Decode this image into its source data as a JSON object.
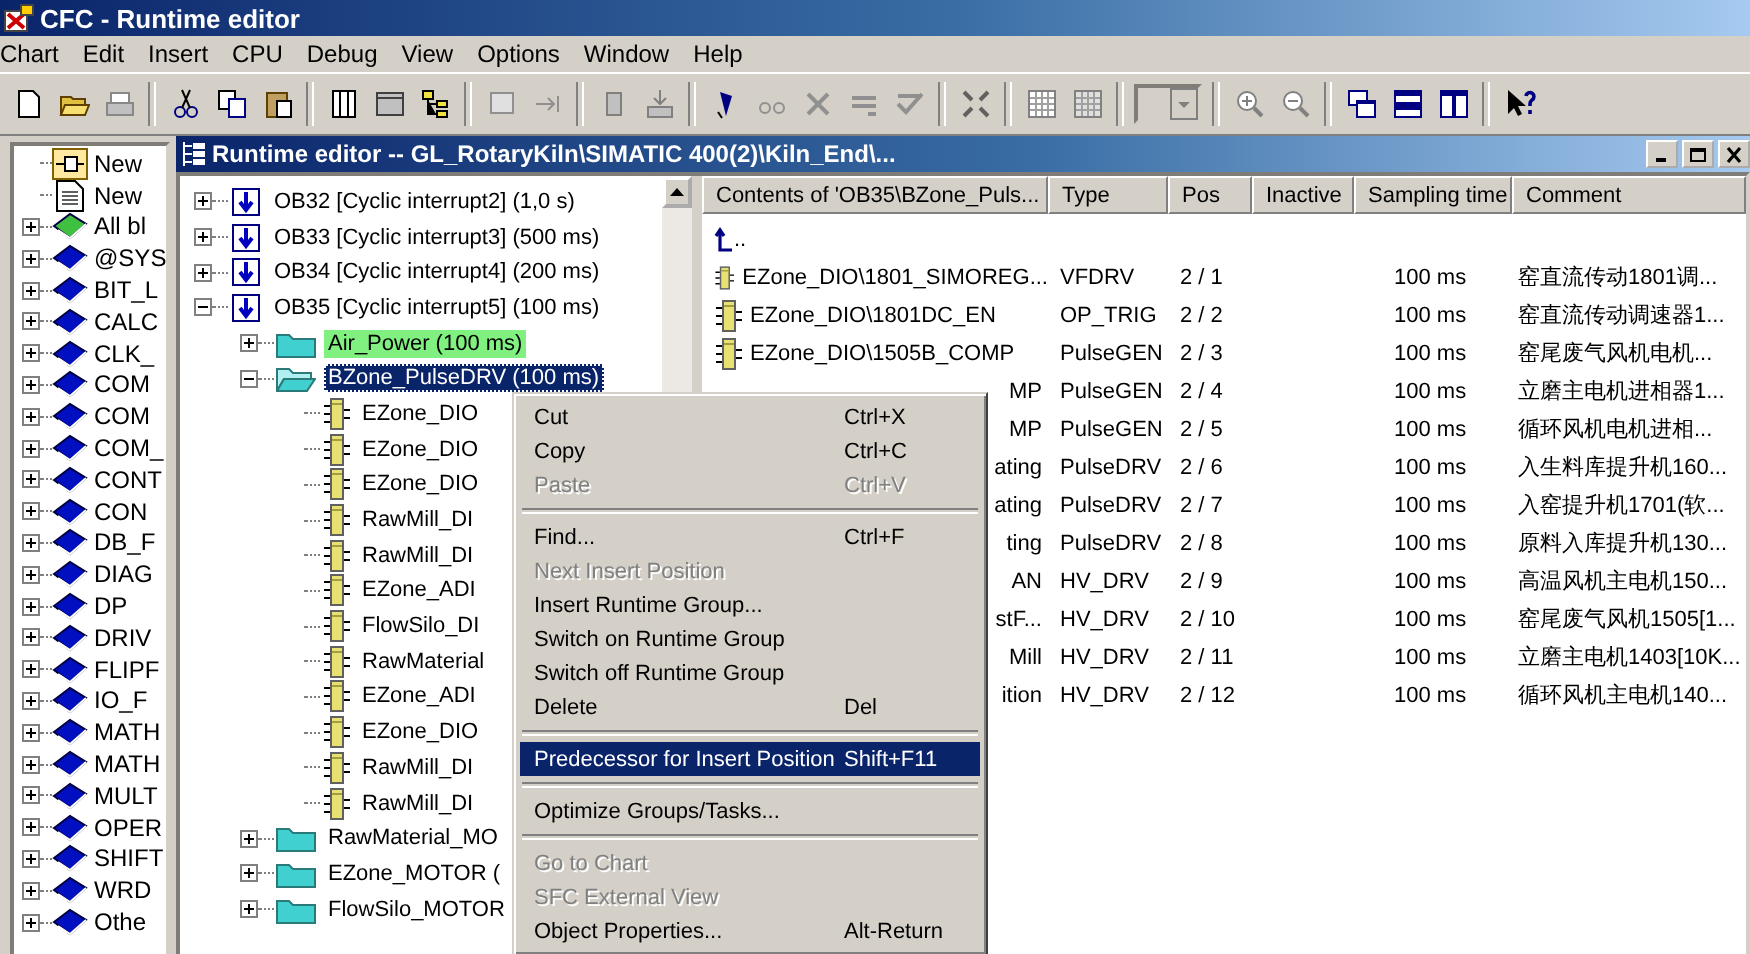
{
  "window": {
    "title": "CFC - Runtime editor"
  },
  "menu_bar": [
    "Chart",
    "Edit",
    "Insert",
    "CPU",
    "Debug",
    "View",
    "Options",
    "Window",
    "Help"
  ],
  "library": [
    {
      "kind": "new-chart",
      "label": "New"
    },
    {
      "kind": "new-doc",
      "label": "New"
    },
    {
      "kind": "library-all",
      "label": "All bl",
      "expanded": false
    },
    {
      "kind": "library",
      "label": "@SYS",
      "expanded": false
    },
    {
      "kind": "library",
      "label": "BIT_L",
      "expanded": false
    },
    {
      "kind": "library",
      "label": "CALC",
      "expanded": false
    },
    {
      "kind": "library",
      "label": "CLK_",
      "expanded": false
    },
    {
      "kind": "library",
      "label": "COM",
      "expanded": false
    },
    {
      "kind": "library",
      "label": "COM",
      "expanded": false
    },
    {
      "kind": "library",
      "label": "COM_",
      "expanded": false
    },
    {
      "kind": "library",
      "label": "CONT",
      "expanded": false
    },
    {
      "kind": "library",
      "label": "CON",
      "expanded": false
    },
    {
      "kind": "library",
      "label": "DB_F",
      "expanded": false
    },
    {
      "kind": "library",
      "label": "DIAG",
      "expanded": false
    },
    {
      "kind": "library",
      "label": "DP",
      "expanded": false
    },
    {
      "kind": "library",
      "label": "DRIV",
      "expanded": false
    },
    {
      "kind": "library",
      "label": "FLIPF",
      "expanded": false
    },
    {
      "kind": "library",
      "label": "IO_F",
      "expanded": false
    },
    {
      "kind": "library",
      "label": "MATH",
      "expanded": false
    },
    {
      "kind": "library",
      "label": "MATH",
      "expanded": false
    },
    {
      "kind": "library",
      "label": "MULT",
      "expanded": false
    },
    {
      "kind": "library",
      "label": "OPER",
      "expanded": false
    },
    {
      "kind": "library",
      "label": "SHIFT",
      "expanded": false
    },
    {
      "kind": "library",
      "label": "WRD",
      "expanded": false
    },
    {
      "kind": "library",
      "label": "Othe",
      "expanded": false
    }
  ],
  "editor": {
    "title": "Runtime editor -- GL_RotaryKiln\\SIMATIC 400(2)\\Kiln_End\\...",
    "tree": [
      {
        "kind": "ob",
        "label": "OB32  [Cyclic interrupt2]  (1,0 s)",
        "expanded": false,
        "selected": false,
        "highlighted": false
      },
      {
        "kind": "ob",
        "label": "OB33  [Cyclic interrupt3]  (500 ms)",
        "expanded": false,
        "selected": false,
        "highlighted": false
      },
      {
        "kind": "ob",
        "label": "OB34  [Cyclic interrupt4]  (200 ms)",
        "expanded": false,
        "selected": false,
        "highlighted": false
      },
      {
        "kind": "ob",
        "label": "OB35  [Cyclic interrupt5]  (100 ms)",
        "expanded": true,
        "selected": false,
        "highlighted": false,
        "children": [
          {
            "kind": "group",
            "label": "Air_Power  (100 ms)",
            "expanded": false,
            "selected": false,
            "highlighted": true
          },
          {
            "kind": "group",
            "label": "BZone_PulseDRV  (100 ms)",
            "expanded": true,
            "selected": true,
            "highlighted": false,
            "children": [
              {
                "kind": "block",
                "label": "EZone_DIO",
                "selected": false,
                "highlighted": false
              },
              {
                "kind": "block",
                "label": "EZone_DIO",
                "selected": false,
                "highlighted": false
              },
              {
                "kind": "block",
                "label": "EZone_DIO",
                "selected": false,
                "highlighted": false
              },
              {
                "kind": "block",
                "label": "RawMill_DI",
                "selected": false,
                "highlighted": false
              },
              {
                "kind": "block",
                "label": "RawMill_DI",
                "selected": false,
                "highlighted": false
              },
              {
                "kind": "block",
                "label": "EZone_ADI",
                "selected": false,
                "highlighted": false
              },
              {
                "kind": "block",
                "label": "FlowSilo_DI",
                "selected": false,
                "highlighted": false
              },
              {
                "kind": "block",
                "label": "RawMaterial",
                "selected": false,
                "highlighted": false
              },
              {
                "kind": "block",
                "label": "EZone_ADI",
                "selected": false,
                "highlighted": false
              },
              {
                "kind": "block",
                "label": "EZone_DIO",
                "selected": false,
                "highlighted": false
              },
              {
                "kind": "block",
                "label": "RawMill_DI",
                "selected": false,
                "highlighted": false
              },
              {
                "kind": "block",
                "label": "RawMill_DI",
                "selected": false,
                "highlighted": false
              }
            ]
          },
          {
            "kind": "group",
            "label": "RawMaterial_MO",
            "expanded": false,
            "selected": false,
            "highlighted": false
          },
          {
            "kind": "group",
            "label": "EZone_MOTOR  (",
            "expanded": false,
            "selected": false,
            "highlighted": false
          },
          {
            "kind": "group",
            "label": "FlowSilo_MOTOR",
            "expanded": false,
            "selected": false,
            "highlighted": false
          }
        ]
      }
    ],
    "list": {
      "columns": [
        "Contents of 'OB35\\BZone_Puls...",
        "Type",
        "Pos",
        "Inactive",
        "Sampling time",
        "Comment"
      ],
      "rows": [
        {
          "kind": "up",
          "name": ".."
        },
        {
          "kind": "block",
          "name": "EZone_DIO\\1801_SIMOREG...",
          "type": "VFDRV",
          "pos": "2 / 1",
          "sampling_time": "100 ms",
          "comment": "窑直流传动1801调..."
        },
        {
          "kind": "block",
          "name": "EZone_DIO\\1801DC_EN",
          "type": "OP_TRIG",
          "pos": "2 / 2",
          "sampling_time": "100 ms",
          "comment": "窑直流传动调速器1..."
        },
        {
          "kind": "block",
          "name": "EZone_DIO\\1505B_COMP",
          "type": "PulseGEN",
          "pos": "2 / 3",
          "sampling_time": "100 ms",
          "comment": "窑尾废气风机电机..."
        },
        {
          "kind": "partial",
          "name": "MP",
          "type": "PulseGEN",
          "pos": "2 / 4",
          "sampling_time": "100 ms",
          "comment": "立磨主电机进相器1..."
        },
        {
          "kind": "partial",
          "name": "MP",
          "type": "PulseGEN",
          "pos": "2 / 5",
          "sampling_time": "100 ms",
          "comment": "循环风机电机进相..."
        },
        {
          "kind": "partial",
          "name": "ating",
          "type": "PulseDRV",
          "pos": "2 / 6",
          "sampling_time": "100 ms",
          "comment": "入生料库提升机160..."
        },
        {
          "kind": "partial",
          "name": "ating",
          "type": "PulseDRV",
          "pos": "2 / 7",
          "sampling_time": "100 ms",
          "comment": "入窑提升机1701(软..."
        },
        {
          "kind": "partial",
          "name": "ting",
          "type": "PulseDRV",
          "pos": "2 / 8",
          "sampling_time": "100 ms",
          "comment": "原料入库提升机130..."
        },
        {
          "kind": "partial",
          "name": "AN",
          "type": "HV_DRV",
          "pos": "2 / 9",
          "sampling_time": "100 ms",
          "comment": "高温风机主电机150..."
        },
        {
          "kind": "partial",
          "name": "stF...",
          "type": "HV_DRV",
          "pos": "2 / 10",
          "sampling_time": "100 ms",
          "comment": "窑尾废气风机1505[1..."
        },
        {
          "kind": "partial",
          "name": "Mill",
          "type": "HV_DRV",
          "pos": "2 / 11",
          "sampling_time": "100 ms",
          "comment": "立磨主电机1403[10K..."
        },
        {
          "kind": "partial",
          "name": "ition",
          "type": "HV_DRV",
          "pos": "2 / 12",
          "sampling_time": "100 ms",
          "comment": "循环风机主电机140..."
        }
      ]
    }
  },
  "context_menu": [
    {
      "kind": "item",
      "label": "Cut",
      "shortcut": "Ctrl+X",
      "disabled": false,
      "selected": false
    },
    {
      "kind": "item",
      "label": "Copy",
      "shortcut": "Ctrl+C",
      "disabled": false,
      "selected": false
    },
    {
      "kind": "item",
      "label": "Paste",
      "shortcut": "Ctrl+V",
      "disabled": true,
      "selected": false
    },
    {
      "kind": "separator"
    },
    {
      "kind": "item",
      "label": "Find...",
      "shortcut": "Ctrl+F",
      "disabled": false,
      "selected": false
    },
    {
      "kind": "item",
      "label": "Next Insert Position",
      "disabled": true,
      "selected": false
    },
    {
      "kind": "item",
      "label": "Insert Runtime Group...",
      "disabled": false,
      "selected": false
    },
    {
      "kind": "item",
      "label": "Switch on Runtime Group",
      "disabled": false,
      "selected": false
    },
    {
      "kind": "item",
      "label": "Switch off Runtime Group",
      "disabled": false,
      "selected": false
    },
    {
      "kind": "item",
      "label": "Delete",
      "shortcut": "Del",
      "disabled": false,
      "selected": false
    },
    {
      "kind": "separator"
    },
    {
      "kind": "item",
      "label": "Predecessor for Insert Position",
      "shortcut": "Shift+F11",
      "disabled": false,
      "selected": true
    },
    {
      "kind": "separator"
    },
    {
      "kind": "item",
      "label": "Optimize Groups/Tasks...",
      "disabled": false,
      "selected": false
    },
    {
      "kind": "separator"
    },
    {
      "kind": "item",
      "label": "Go to Chart",
      "disabled": true,
      "selected": false
    },
    {
      "kind": "item",
      "label": "SFC External View",
      "disabled": true,
      "selected": false
    },
    {
      "kind": "item",
      "label": "Object Properties...",
      "shortcut": "Alt-Return",
      "disabled": false,
      "selected": false
    }
  ]
}
